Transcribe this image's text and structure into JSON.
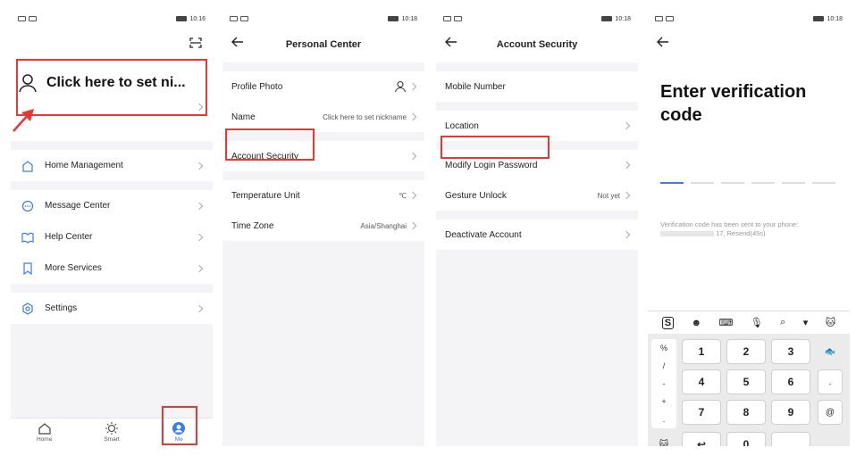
{
  "phone1": {
    "status": {
      "time": "10:16"
    },
    "nickname": "Click here to set ni...",
    "menu": {
      "home": "Home Management",
      "message": "Message Center",
      "help": "Help Center",
      "more": "More Services",
      "settings": "Settings"
    },
    "tabs": {
      "home": "Home",
      "smart": "Smart",
      "me": "Me"
    }
  },
  "phone2": {
    "status": {
      "time": "10:18"
    },
    "title": "Personal Center",
    "rows": {
      "profile_photo": "Profile Photo",
      "name": "Name",
      "name_value": "Click here to set nickname",
      "account_security": "Account Security",
      "temperature_unit": "Temperature Unit",
      "temperature_value": "℃",
      "time_zone": "Time Zone",
      "time_zone_value": "Asia/Shanghai"
    }
  },
  "phone3": {
    "status": {
      "time": "10:18"
    },
    "title": "Account Security",
    "rows": {
      "mobile_number": "Mobile Number",
      "location": "Location",
      "modify_password": "Modify Login Password",
      "gesture_unlock": "Gesture Unlock",
      "gesture_value": "Not yet",
      "deactivate": "Deactivate Account"
    }
  },
  "phone4": {
    "status": {
      "time": "10:18"
    },
    "title_line1": "Enter verification",
    "title_line2": "code",
    "note_line1": "Verification code has been sent to your phone:",
    "note_line2": "17, Resend(45s)",
    "keyboard": {
      "side": [
        "%",
        "/",
        "-",
        "+",
        "."
      ],
      "keys": [
        "1",
        "2",
        "3",
        ".",
        "4",
        "5",
        "6",
        ".",
        "7",
        "8",
        "9",
        "@",
        "0"
      ]
    }
  },
  "colors": {
    "accent": "#3d7dea",
    "highlight": "#e53935"
  }
}
